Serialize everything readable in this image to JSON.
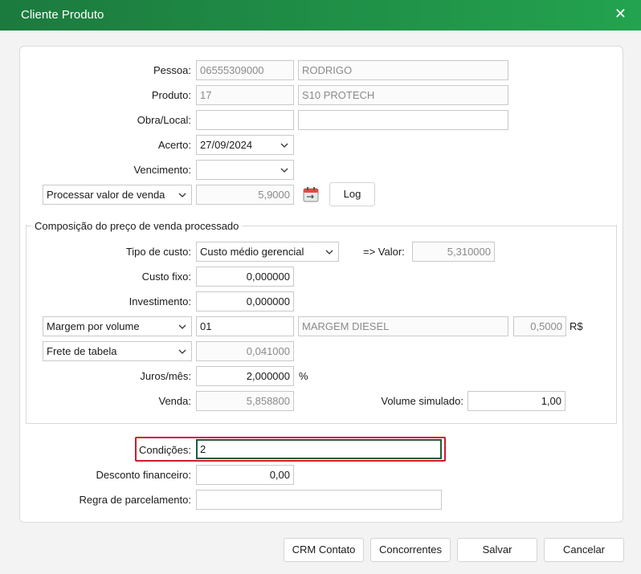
{
  "window": {
    "title": "Cliente Produto"
  },
  "form": {
    "pessoa": {
      "label": "Pessoa:",
      "code": "06555309000",
      "name": "RODRIGO"
    },
    "produto": {
      "label": "Produto:",
      "code": "17",
      "name": "S10 PROTECH"
    },
    "obra_local": {
      "label": "Obra/Local:",
      "code": "",
      "name": ""
    },
    "acerto": {
      "label": "Acerto:",
      "value": "27/09/2024"
    },
    "vencimento": {
      "label": "Vencimento:",
      "value": ""
    },
    "processar": {
      "select": "Processar valor de venda",
      "value": "5,9000",
      "log_button": "Log"
    }
  },
  "composicao": {
    "title": "Composição do preço de venda processado",
    "tipo_custo": {
      "label": "Tipo de custo:",
      "value": "Custo médio gerencial",
      "valor_label": "=> Valor:",
      "valor": "5,310000"
    },
    "custo_fixo": {
      "label": "Custo fixo:",
      "value": "0,000000"
    },
    "investimento": {
      "label": "Investimento:",
      "value": "0,000000"
    },
    "margem": {
      "select": "Margem por volume",
      "code": "01",
      "name": "MARGEM DIESEL",
      "value": "0,5000",
      "unit": "R$"
    },
    "frete": {
      "select": "Frete de tabela",
      "value": "0,041000"
    },
    "juros": {
      "label": "Juros/mês:",
      "value": "2,000000",
      "unit": "%"
    },
    "venda": {
      "label": "Venda:",
      "value": "5,858800",
      "volume_label": "Volume simulado:",
      "volume": "1,00"
    }
  },
  "condicoes": {
    "label": "Condições:",
    "value": "2",
    "desconto": {
      "label": "Desconto financeiro:",
      "value": "0,00"
    },
    "regra": {
      "label": "Regra de parcelamento:",
      "value": ""
    }
  },
  "footer": {
    "crm": "CRM Contato",
    "concorrentes": "Concorrentes",
    "salvar": "Salvar",
    "cancelar": "Cancelar"
  },
  "colors": {
    "title_bar": "#1f8a45",
    "highlight": "#d11a2a",
    "focus": "#1d5c37"
  },
  "icons": {
    "close": "close-icon",
    "calendar": "calendar-icon",
    "dropdown": "chevron-down-icon"
  }
}
